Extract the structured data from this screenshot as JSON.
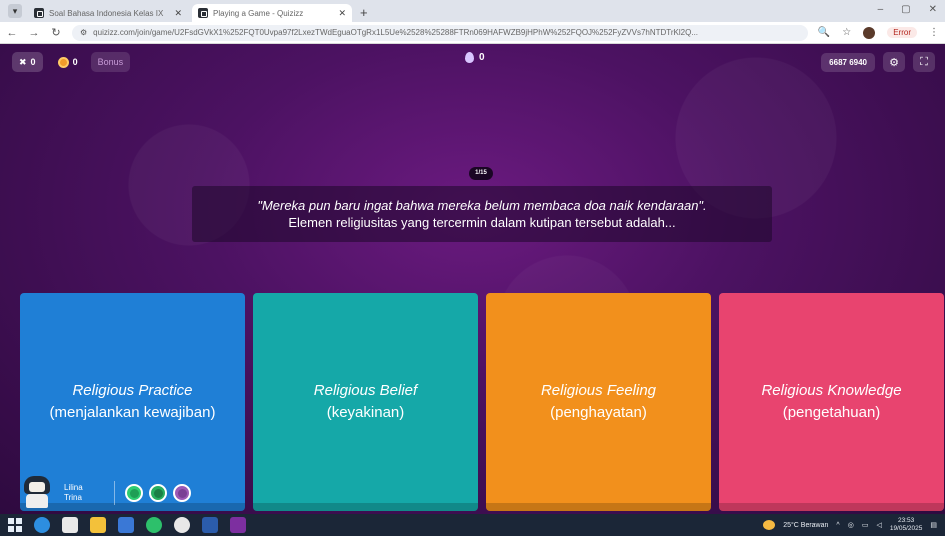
{
  "browser": {
    "tabs": [
      {
        "title": "Soal Bahasa Indonesia Kelas IX",
        "active": false
      },
      {
        "title": "Playing a Game - Quizizz",
        "active": true
      }
    ],
    "new_tab_label": "+",
    "url": "quizizz.com/join/game/U2FsdGVkX1%252FQT0Uvpa97f2LxezTWdEguaOTgRx1L5Ue%2528%25288FTRn069HAFWZB9jHPhW%252FQOJ%252FyZVVs7hNTDTrKl2Q...",
    "error_label": "Error",
    "window_controls": [
      "–",
      "▢",
      "✕"
    ]
  },
  "game": {
    "streak_value": "0",
    "coins_value": "0",
    "bonus_label": "Bonus",
    "score_value": "0",
    "game_code": "6687 6940",
    "question_counter": "1/15",
    "question_line1": "\"Mereka pun baru ingat bahwa mereka belum membaca doa naik kendaraan\".",
    "question_line2": "Elemen religiusitas yang tercermin dalam kutipan tersebut adalah...",
    "answers": [
      {
        "title": "Religious Practice",
        "sub": "(menjalankan kewajiban)",
        "color": "#1f7fd6"
      },
      {
        "title": "Religious Belief",
        "sub": "(keyakinan)",
        "color": "#15a8a8"
      },
      {
        "title": "Religious Feeling",
        "sub": "(penghayatan)",
        "color": "#f2901c"
      },
      {
        "title": "Religious Knowledge",
        "sub": "(pengetahuan)",
        "color": "#e8446f"
      }
    ],
    "player": {
      "first_name": "Lilina",
      "last_name": "Trina"
    },
    "powerup_colors": [
      "#2ecc71",
      "#27ae60",
      "#9b59b6"
    ]
  },
  "taskbar": {
    "weather": "25°C Berawan",
    "time": "23:53",
    "date": "19/05/2025"
  }
}
